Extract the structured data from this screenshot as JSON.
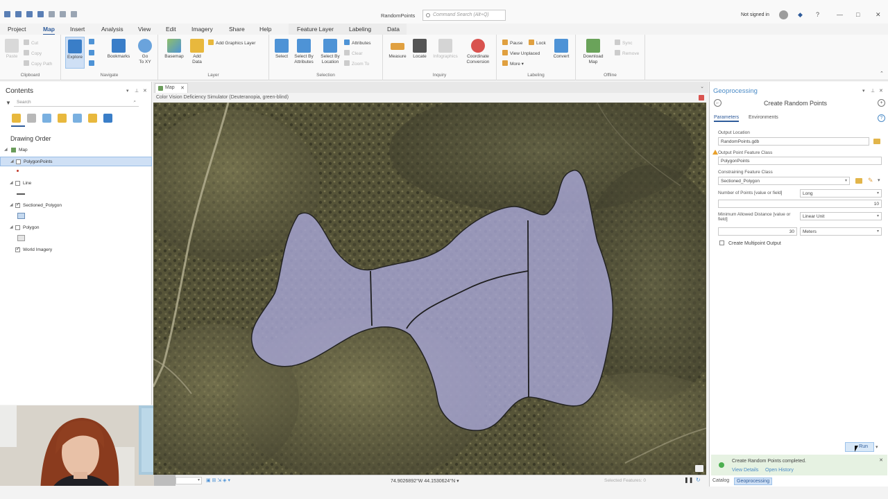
{
  "app": {
    "title": "RandomPoints",
    "command_search_placeholder": "Command Search (Alt+Q)",
    "sign_in": "Not signed in",
    "window_controls": [
      "help",
      "minimize",
      "maximize",
      "close"
    ]
  },
  "ribbon": {
    "tabs": [
      "Project",
      "Map",
      "Insert",
      "Analysis",
      "View",
      "Edit",
      "Imagery",
      "Share",
      "Help",
      "Feature Layer",
      "Labeling",
      "Data"
    ],
    "active_tab": "Map",
    "groups": {
      "clipboard": {
        "label": "Clipboard",
        "paste": "Paste",
        "cut": "Cut",
        "copy": "Copy",
        "copy_path": "Copy Path"
      },
      "navigate": {
        "label": "Navigate",
        "explore": "Explore",
        "bookmarks": "Bookmarks",
        "goto": "Go\nTo XY"
      },
      "layer": {
        "label": "Layer",
        "basemap": "Basemap",
        "add_data": "Add\nData",
        "add_graphics": "Add Graphics Layer"
      },
      "selection": {
        "label": "Selection",
        "select": "Select",
        "select_attr": "Select By\nAttributes",
        "select_loc": "Select By\nLocation",
        "attributes": "Attributes",
        "clear": "Clear",
        "zoom_to": "Zoom To"
      },
      "inquiry": {
        "label": "Inquiry",
        "measure": "Measure",
        "locate": "Locate",
        "infographics": "Infographics",
        "coord_conv": "Coordinate\nConversion"
      },
      "labeling": {
        "label": "Labeling",
        "pause": "Pause",
        "lock": "Lock",
        "view_unplaced": "View Unplaced",
        "more": "More",
        "convert": "Convert"
      },
      "offline": {
        "label": "Offline",
        "download": "Download\nMap",
        "sync": "Sync",
        "remove": "Remove"
      }
    }
  },
  "contents": {
    "title": "Contents",
    "search_placeholder": "Search",
    "section": "Drawing Order",
    "layers": [
      {
        "label": "Map",
        "checked": true
      },
      {
        "label": "PolygonPoints",
        "checked": false,
        "selected": true
      },
      {
        "label": "Line",
        "checked": false
      },
      {
        "label": "Sectioned_Polygon",
        "checked": true
      },
      {
        "label": "Polygon",
        "checked": false
      },
      {
        "label": "World Imagery",
        "checked": true
      }
    ]
  },
  "map": {
    "tab_label": "Map",
    "simulator_text": "Color Vision Deficiency Simulator (Deuteranopia, green-blind)",
    "coordinates": "74.9026892°W 44.1530624°N",
    "selected_features": "Selected Features: 0"
  },
  "geoprocessing": {
    "pane_title": "Geoprocessing",
    "tool_name": "Create Random Points",
    "tabs": [
      "Parameters",
      "Environments"
    ],
    "params": {
      "output_location_label": "Output Location",
      "output_location_value": "RandomPoints.gdb",
      "output_fc_label": "Output Point Feature Class",
      "output_fc_value": "PolygonPoints",
      "constraining_label": "Constraining Feature Class",
      "constraining_value": "Sectioned_Polygon",
      "num_points_label": "Number of Points [value or field]",
      "num_points_type": "Long",
      "num_points_value": "10",
      "min_dist_label": "Minimum Allowed Distance [value or field]",
      "min_dist_type": "Linear Unit",
      "min_dist_value": "30",
      "min_dist_unit": "Meters",
      "multipoint_label": "Create Multipoint Output"
    },
    "run_label": "Run",
    "completed_message": "Create Random Points completed.",
    "view_details": "View Details",
    "open_history": "Open History",
    "bottom_tabs": [
      "Catalog",
      "Geoprocessing"
    ]
  },
  "colors": {
    "accent": "#2e5b9a",
    "geoprocessing_title": "#4a8ac6",
    "polygon_fill": "#a7a6d4",
    "success": "#4caf50"
  }
}
